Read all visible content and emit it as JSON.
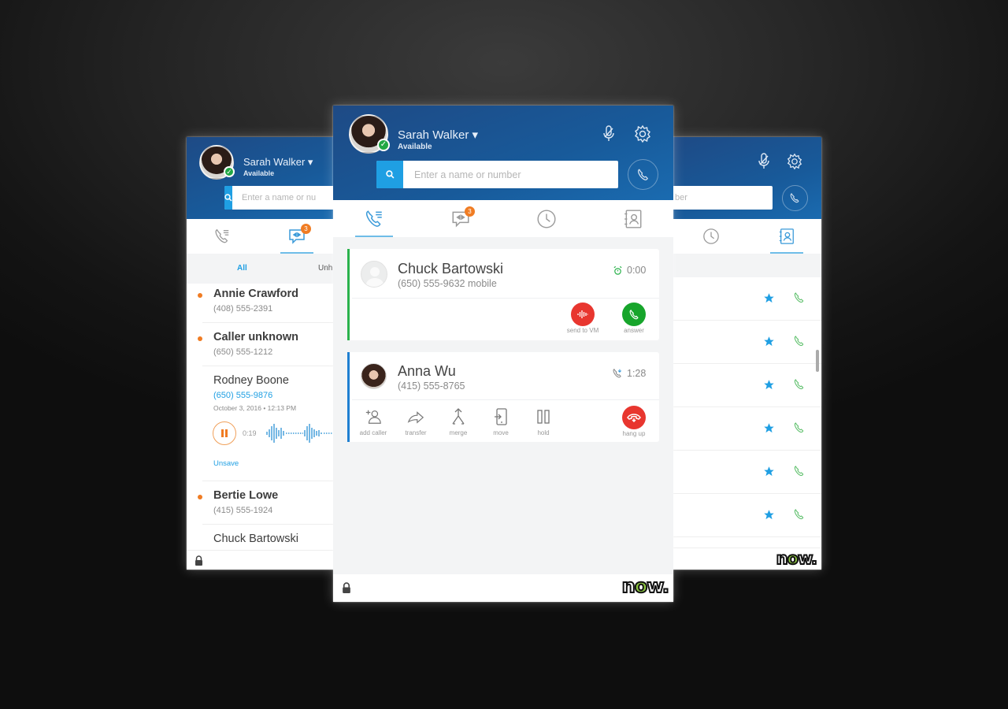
{
  "user": {
    "name": "Sarah Walker",
    "status": "Available"
  },
  "search": {
    "placeholder": "Enter a name or number",
    "placeholder_left": "Enter a name or nu",
    "placeholder_right": "ber"
  },
  "tabs": [
    {
      "id": "calls",
      "icon": "phone-list-icon"
    },
    {
      "id": "messages",
      "icon": "chat-icon",
      "badge": "3"
    },
    {
      "id": "history",
      "icon": "clock-icon"
    },
    {
      "id": "contacts",
      "icon": "contact-book-icon"
    }
  ],
  "left_panel": {
    "active_tab": "messages",
    "filters": {
      "all": "All",
      "unheard": "Unh"
    },
    "items": [
      {
        "name": "Annie Crawford",
        "phone": "(408) 555-2391",
        "unread": true
      },
      {
        "name": "Caller unknown",
        "phone": "(650) 555-1212",
        "unread": true
      },
      {
        "name": "Rodney Boone",
        "phone": "(650) 555-9876",
        "date": "October 3, 2016 • 12:13 PM",
        "playback_time": "0:19",
        "unsave": "Unsave",
        "unread": false
      },
      {
        "name": "Bertie Lowe",
        "phone": "(415) 555-1924",
        "unread": true
      },
      {
        "name": "Chuck Bartowski",
        "unread": false
      }
    ]
  },
  "center_panel": {
    "active_tab": "calls",
    "calls": [
      {
        "name": "Chuck Bartowski",
        "number": "(650) 555-9632 mobile",
        "time": "0:00",
        "state": "ringing",
        "accent": "#2bb24c",
        "actions": [
          {
            "label": "send to VM",
            "color": "#e8362f"
          },
          {
            "label": "answer",
            "color": "#17a52b"
          }
        ]
      },
      {
        "name": "Anna Wu",
        "number": "(415) 555-8765",
        "time": "1:28",
        "state": "active",
        "accent": "#1f7fd1",
        "actions": [
          {
            "label": "add caller"
          },
          {
            "label": "transfer"
          },
          {
            "label": "merge"
          },
          {
            "label": "move"
          },
          {
            "label": "hold"
          },
          {
            "label": "hang up",
            "color": "#e8362f"
          }
        ]
      }
    ]
  },
  "right_panel": {
    "active_tab": "contacts",
    "rows": 6
  },
  "brand": {
    "logo": "now",
    "accent": "#8bc53f"
  },
  "colors": {
    "header": "#1a5a9c",
    "link": "#1f9fe3",
    "unread": "#f07c23"
  }
}
